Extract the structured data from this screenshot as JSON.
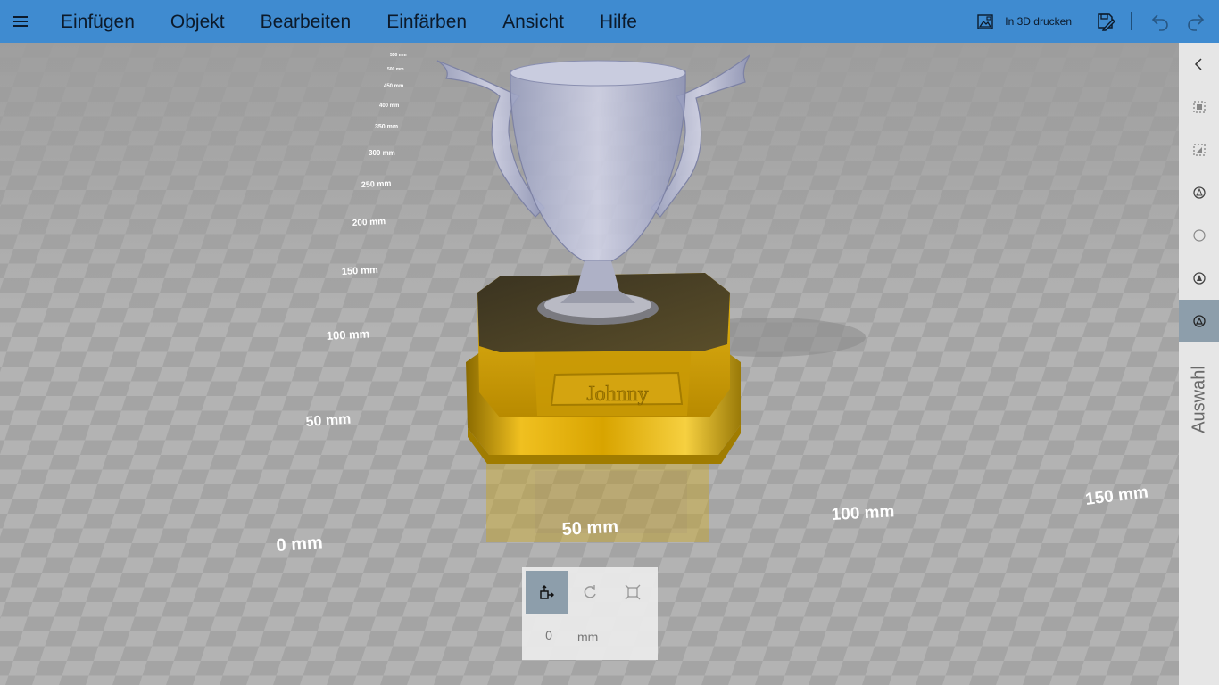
{
  "menu": {
    "items": [
      "Einfügen",
      "Objekt",
      "Bearbeiten",
      "Einfärben",
      "Ansicht",
      "Hilfe"
    ]
  },
  "toolbar": {
    "print_label": "In 3D drucken"
  },
  "viewport": {
    "ruler_left": [
      "0 mm",
      "50 mm",
      "100 mm",
      "150 mm",
      "200 mm",
      "250 mm",
      "300 mm",
      "350 mm",
      "400 mm",
      "450 mm",
      "500 mm",
      "550 mm"
    ],
    "ruler_bottom": [
      "50 mm",
      "100 mm",
      "150 mm"
    ],
    "engraving": "Johnny"
  },
  "side_panel": {
    "label": "Auswahl"
  },
  "transform": {
    "value": "0",
    "unit": "mm"
  }
}
